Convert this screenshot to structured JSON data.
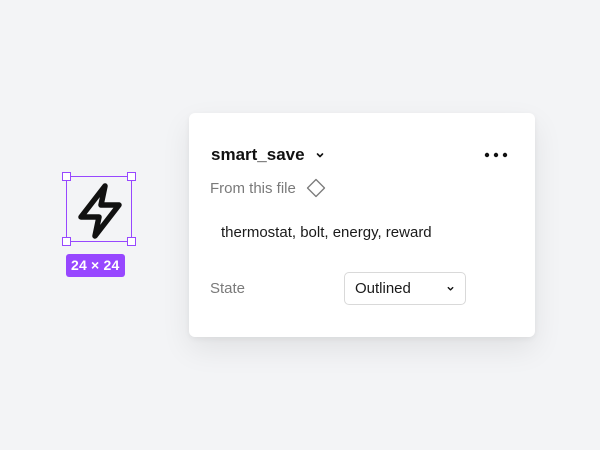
{
  "canvas": {
    "selection_color": "#9747ff",
    "selected_icon": "bolt-icon",
    "size_badge": "24 × 24"
  },
  "panel": {
    "component_name": "smart_save",
    "name_dropdown_icon": "chevron-down-icon",
    "more_icon": "more-horizontal-icon",
    "source_label": "From this file",
    "source_icon": "component-diamond-icon",
    "tags": "thermostat, bolt, energy, reward",
    "state": {
      "label": "State",
      "value": "Outlined",
      "icon": "chevron-down-icon"
    }
  }
}
